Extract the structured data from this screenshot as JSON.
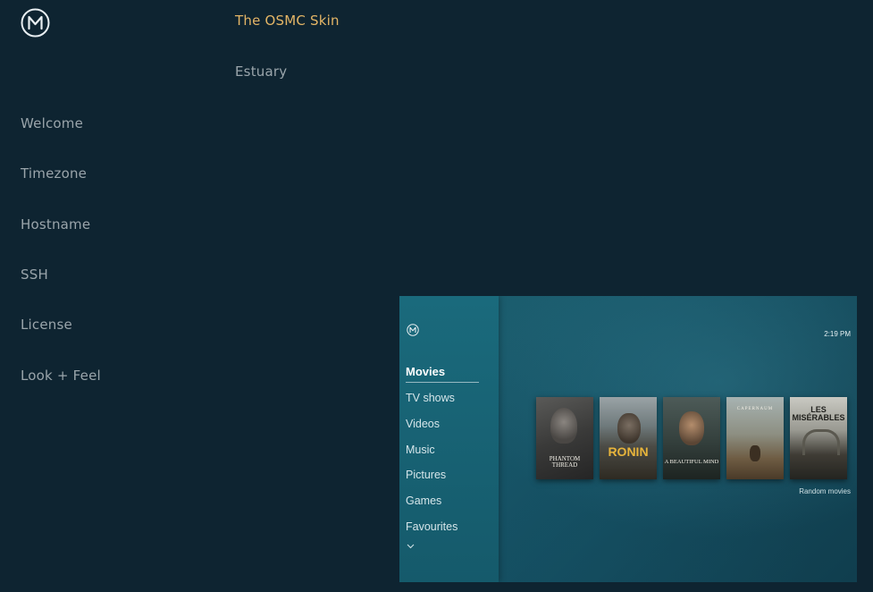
{
  "sidebar": {
    "logo_icon": "osmc-logo-icon",
    "items": [
      {
        "label": "Welcome"
      },
      {
        "label": "Timezone"
      },
      {
        "label": "Hostname"
      },
      {
        "label": "SSH"
      },
      {
        "label": "License"
      },
      {
        "label": "Look + Feel"
      }
    ]
  },
  "skins": {
    "options": [
      {
        "label": "The OSMC Skin",
        "selected": true
      },
      {
        "label": "Estuary",
        "selected": false
      }
    ],
    "selected_color": "#e3b566"
  },
  "preview": {
    "clock": "2:19 PM",
    "menu": [
      {
        "label": "Movies",
        "active": true
      },
      {
        "label": "TV shows"
      },
      {
        "label": "Videos"
      },
      {
        "label": "Music"
      },
      {
        "label": "Pictures"
      },
      {
        "label": "Games"
      },
      {
        "label": "Favourites"
      }
    ],
    "more_icon": "chevron-down-icon",
    "posters": [
      {
        "title": "PHANTOM THREAD"
      },
      {
        "title": "RONIN"
      },
      {
        "title": "A BEAUTIFUL MIND"
      },
      {
        "title": "CAPERNAUM"
      },
      {
        "title": "LES MISÉRABLES"
      }
    ],
    "caption": "Random movies"
  },
  "colors": {
    "background": "#0e2431",
    "text": "#9aa5ab",
    "accent": "#e3b566"
  }
}
